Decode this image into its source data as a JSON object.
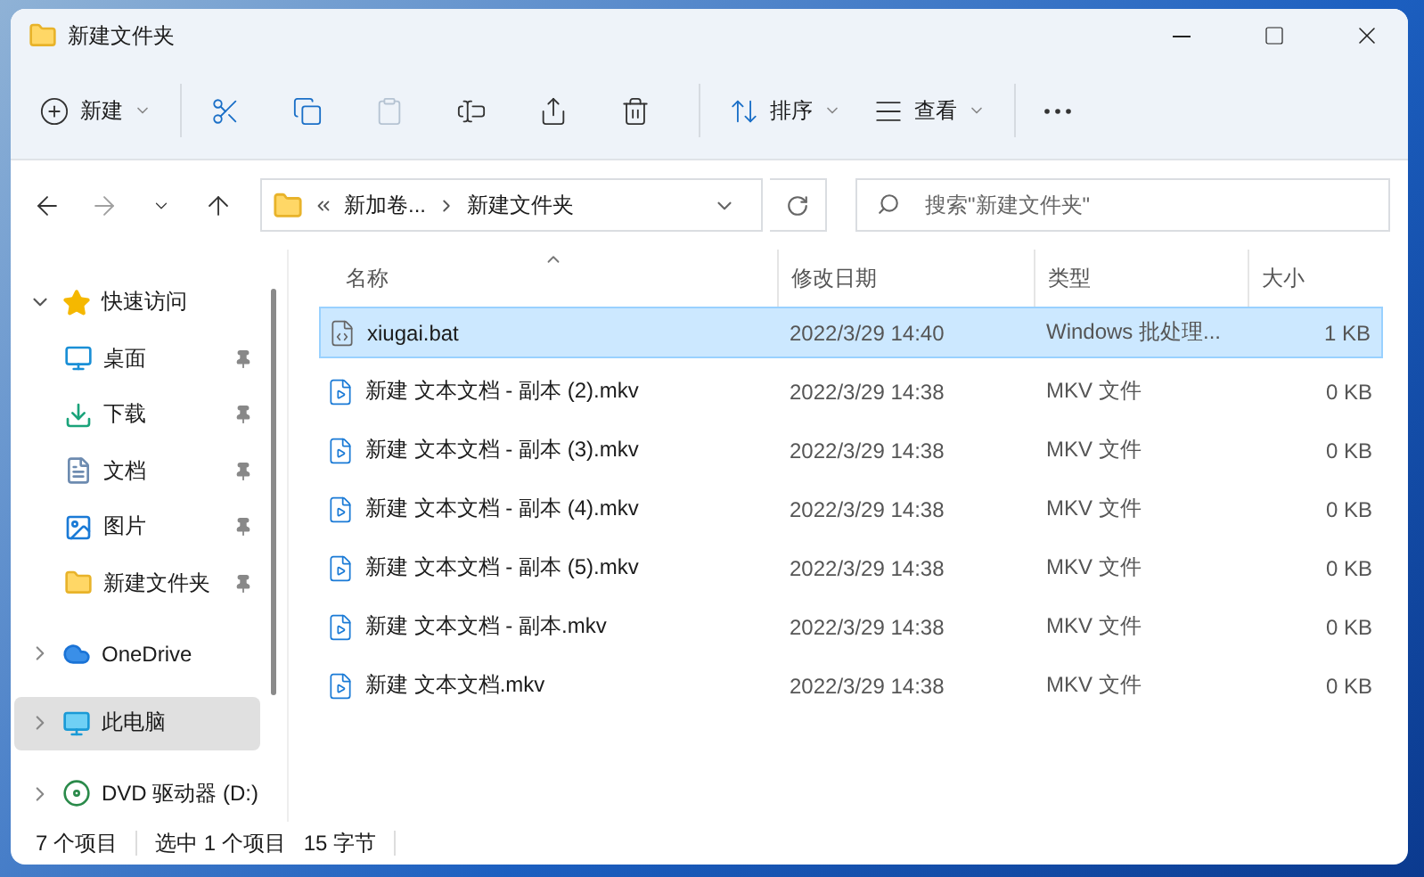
{
  "window": {
    "title": "新建文件夹"
  },
  "toolbar": [
    {
      "kind": "new",
      "label": "新建",
      "disabled": false
    },
    {
      "kind": "cut",
      "disabled": false
    },
    {
      "kind": "copy",
      "disabled": false
    },
    {
      "kind": "paste",
      "disabled": true
    },
    {
      "kind": "rename",
      "disabled": false
    },
    {
      "kind": "share",
      "disabled": false
    },
    {
      "kind": "delete",
      "disabled": false
    },
    {
      "kind": "sort",
      "label": "排序",
      "disabled": false
    },
    {
      "kind": "view",
      "label": "查看",
      "disabled": false
    },
    {
      "kind": "more",
      "disabled": false
    }
  ],
  "nav": [
    {
      "kind": "back",
      "disabled": false
    },
    {
      "kind": "forward",
      "disabled": true
    },
    {
      "kind": "recent",
      "disabled": false
    },
    {
      "kind": "up",
      "disabled": false
    }
  ],
  "address": {
    "segments": [
      "新加卷...",
      "新建文件夹"
    ]
  },
  "search": {
    "placeholder": "搜索\"新建文件夹\""
  },
  "sidebar": [
    {
      "kind": "star",
      "label": "快速访问",
      "expanded": true,
      "selected": false,
      "children": [
        {
          "kind": "desktop",
          "label": "桌面",
          "pinned": true,
          "selected": false
        },
        {
          "kind": "download",
          "label": "下载",
          "pinned": true,
          "selected": false
        },
        {
          "kind": "docs",
          "label": "文档",
          "pinned": true,
          "selected": false
        },
        {
          "kind": "pictures",
          "label": "图片",
          "pinned": true,
          "selected": false
        },
        {
          "kind": "folder",
          "label": "新建文件夹",
          "pinned": true,
          "selected": false
        }
      ]
    },
    {
      "kind": "cloud",
      "label": "OneDrive",
      "expanded": false,
      "selected": false
    },
    {
      "kind": "pc",
      "label": "此电脑",
      "expanded": false,
      "selected": true
    },
    {
      "kind": "dvd",
      "label": "DVD 驱动器 (D:)",
      "expanded": false,
      "selected": false
    }
  ],
  "table": {
    "columns": [
      {
        "label": "名称",
        "sorted": true
      },
      {
        "label": "修改日期",
        "sorted": false
      },
      {
        "label": "类型",
        "sorted": false
      },
      {
        "label": "大小",
        "sorted": false
      }
    ],
    "rows": [
      {
        "kind": "bat",
        "selected": true,
        "name": "xiugai.bat",
        "date": "2022/3/29 14:40",
        "type": "Windows 批处理...",
        "size": "1 KB"
      },
      {
        "kind": "mkv",
        "selected": false,
        "name": "新建 文本文档 - 副本 (2).mkv",
        "date": "2022/3/29 14:38",
        "type": "MKV 文件",
        "size": "0 KB"
      },
      {
        "kind": "mkv",
        "selected": false,
        "name": "新建 文本文档 - 副本 (3).mkv",
        "date": "2022/3/29 14:38",
        "type": "MKV 文件",
        "size": "0 KB"
      },
      {
        "kind": "mkv",
        "selected": false,
        "name": "新建 文本文档 - 副本 (4).mkv",
        "date": "2022/3/29 14:38",
        "type": "MKV 文件",
        "size": "0 KB"
      },
      {
        "kind": "mkv",
        "selected": false,
        "name": "新建 文本文档 - 副本 (5).mkv",
        "date": "2022/3/29 14:38",
        "type": "MKV 文件",
        "size": "0 KB"
      },
      {
        "kind": "mkv",
        "selected": false,
        "name": "新建 文本文档 - 副本.mkv",
        "date": "2022/3/29 14:38",
        "type": "MKV 文件",
        "size": "0 KB"
      },
      {
        "kind": "mkv",
        "selected": false,
        "name": "新建 文本文档.mkv",
        "date": "2022/3/29 14:38",
        "type": "MKV 文件",
        "size": "0 KB"
      }
    ]
  },
  "status": [
    "7 个项目",
    "选中 1 个项目",
    "15 字节"
  ]
}
